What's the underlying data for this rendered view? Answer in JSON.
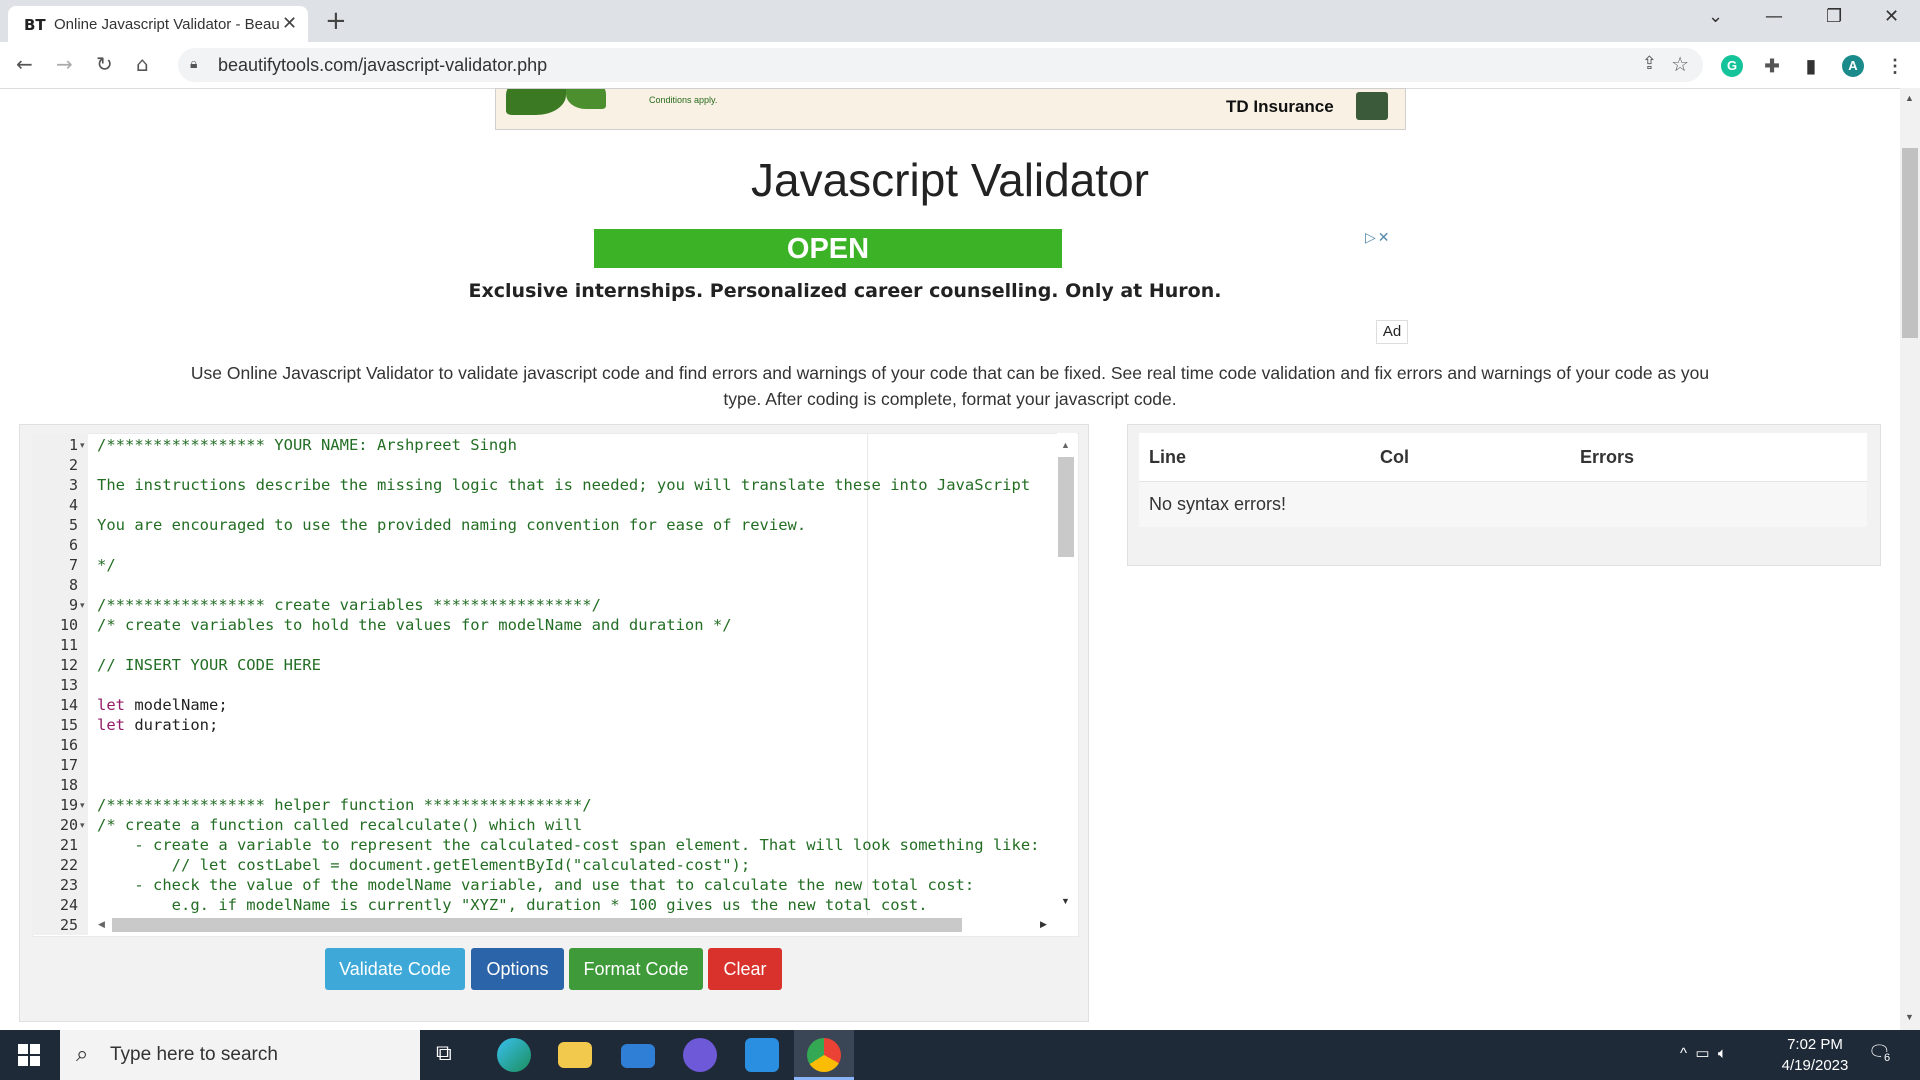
{
  "browser": {
    "tab_favicon": "BT",
    "tab_title": "Online Javascript Validator - Beau",
    "tab_close": "✕",
    "new_tab": "+",
    "url": "beautifytools.com/javascript-validator.php",
    "profile_initial": "A",
    "grammarly_initial": "G"
  },
  "top_ad": {
    "conditions": "Conditions apply.",
    "brand": "TD Insurance"
  },
  "page": {
    "title": "Javascript Validator",
    "description": "Use Online Javascript Validator to validate javascript code and find errors and warnings of your code that can be fixed. See real time code validation and fix errors and warnings of your code as you type. After coding is complete, format your javascript code."
  },
  "banner_ad": {
    "button_label": "OPEN",
    "text": "Exclusive internships. Personalized career counselling. Only at Huron.",
    "ad_label": "Ad",
    "choices": "▷✕"
  },
  "editor": {
    "line_numbers": [
      "1",
      "2",
      "3",
      "4",
      "5",
      "6",
      "7",
      "8",
      "9",
      "10",
      "11",
      "12",
      "13",
      "14",
      "15",
      "16",
      "17",
      "18",
      "19",
      "20",
      "21",
      "22",
      "23",
      "24",
      "25"
    ],
    "lines": [
      [
        {
          "t": "/***************** YOUR NAME: Arshpreet Singh",
          "c": "c-com"
        }
      ],
      [],
      [
        {
          "t": "The instructions describe the missing logic that is needed; you will translate these into JavaScript",
          "c": "c-com"
        }
      ],
      [],
      [
        {
          "t": "You are encouraged to use the provided naming convention for ease of review.",
          "c": "c-com"
        }
      ],
      [],
      [
        {
          "t": "*/",
          "c": "c-com"
        }
      ],
      [],
      [
        {
          "t": "/***************** create variables *****************/",
          "c": "c-com"
        }
      ],
      [
        {
          "t": "/* create variables to hold the values for modelName and duration */",
          "c": "c-com"
        }
      ],
      [],
      [
        {
          "t": "// INSERT YOUR CODE HERE",
          "c": "c-com"
        }
      ],
      [],
      [
        {
          "t": "let",
          "c": "c-kw"
        },
        {
          "t": " modelName;",
          "c": "c-id"
        }
      ],
      [
        {
          "t": "let",
          "c": "c-kw"
        },
        {
          "t": " duration;",
          "c": "c-id"
        }
      ],
      [],
      [],
      [],
      [
        {
          "t": "/***************** helper function *****************/",
          "c": "c-com"
        }
      ],
      [
        {
          "t": "/* create a function called recalculate() which will",
          "c": "c-com"
        }
      ],
      [
        {
          "t": "    - create a variable to represent the calculated-cost span element. That will look something like:",
          "c": "c-com"
        }
      ],
      [
        {
          "t": "        // let costLabel = document.getElementById(\"calculated-cost\");",
          "c": "c-com"
        }
      ],
      [
        {
          "t": "    - check the value of the modelName variable, and use that to calculate the new total cost:",
          "c": "c-com"
        }
      ],
      [
        {
          "t": "        e.g. if modelName is currently \"XYZ\", duration * 100 gives us the new total cost.",
          "c": "c-com"
        }
      ],
      []
    ],
    "fold_lines": [
      1,
      9,
      19,
      20
    ]
  },
  "buttons": {
    "validate": "Validate Code",
    "options": "Options",
    "format": "Format Code",
    "clear": "Clear"
  },
  "errors_table": {
    "headers": [
      "Line",
      "Col",
      "Errors"
    ],
    "message": "No syntax errors!"
  },
  "taskbar": {
    "search_placeholder": "Type here to search",
    "time": "7:02 PM",
    "date": "4/19/2023",
    "notification_count": "6"
  },
  "colors": {
    "open_button": "#3cb227",
    "validate_button": "#3ea9d8",
    "options_button": "#2b64a8",
    "format_button": "#3f9b3a",
    "clear_button": "#d9312b"
  }
}
